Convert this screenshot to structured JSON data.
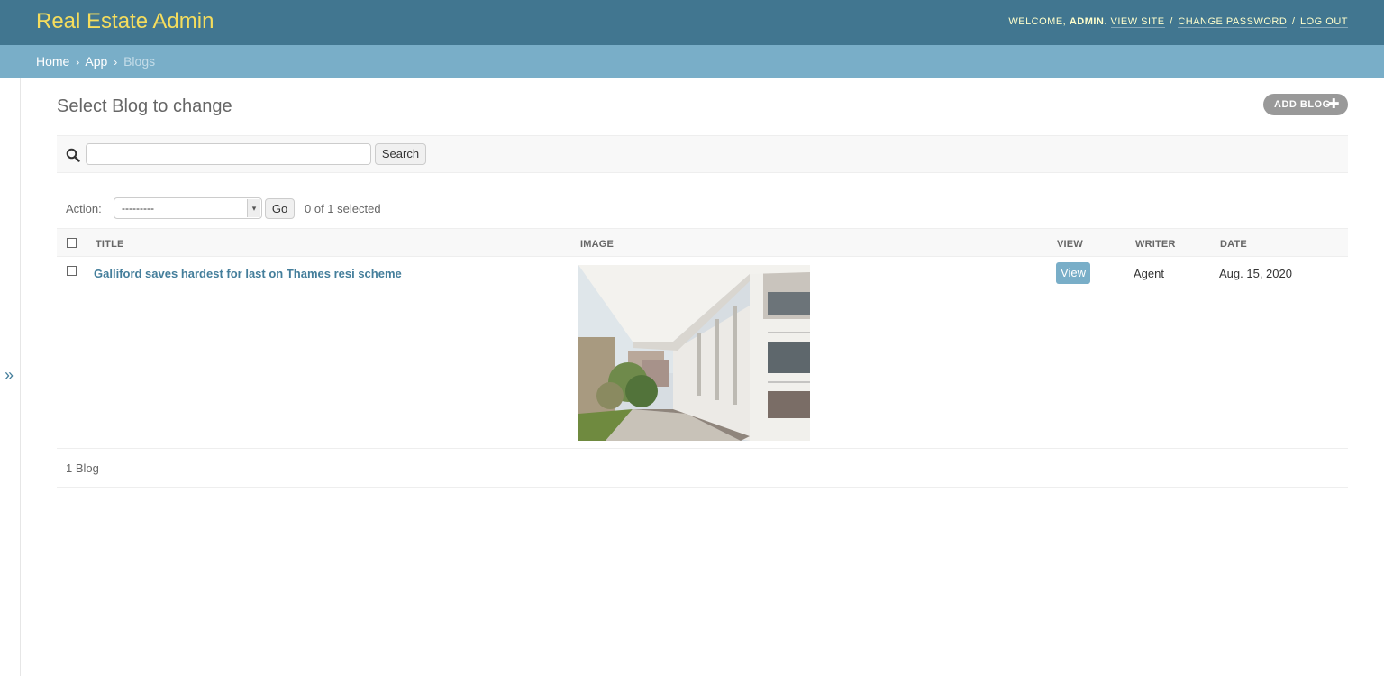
{
  "header": {
    "brand": "Real Estate Admin",
    "welcome": "Welcome,",
    "username": "admin",
    "view_site": "View site",
    "change_password": "Change password",
    "log_out": "Log out",
    "sep": "/"
  },
  "breadcrumbs": {
    "home": "Home",
    "app": "App",
    "current": "Blogs",
    "arrow": "›"
  },
  "sidebar": {
    "toggle_icon": "»"
  },
  "content": {
    "title": "Select Blog to change",
    "add_label": "Add Blog",
    "add_icon": "✚"
  },
  "search": {
    "placeholder": "",
    "button_label": "Search"
  },
  "actions": {
    "label": "Action:",
    "selected_value": "---------",
    "go_label": "Go",
    "selected_count": "0 of 1 selected"
  },
  "table": {
    "columns": [
      "Title",
      "Image",
      "View",
      "Writer",
      "Date"
    ],
    "rows": [
      {
        "title": "Galliford saves hardest for last on Thames resi scheme",
        "view_label": "View",
        "writer": "Agent",
        "date": "Aug. 15, 2020"
      }
    ]
  },
  "paginator": {
    "count": "1 Blog"
  },
  "colors": {
    "header_bg": "#417690",
    "breadcrumb_bg": "#79aec8",
    "brand_text": "#f5dd5d",
    "link": "#447e9b"
  }
}
